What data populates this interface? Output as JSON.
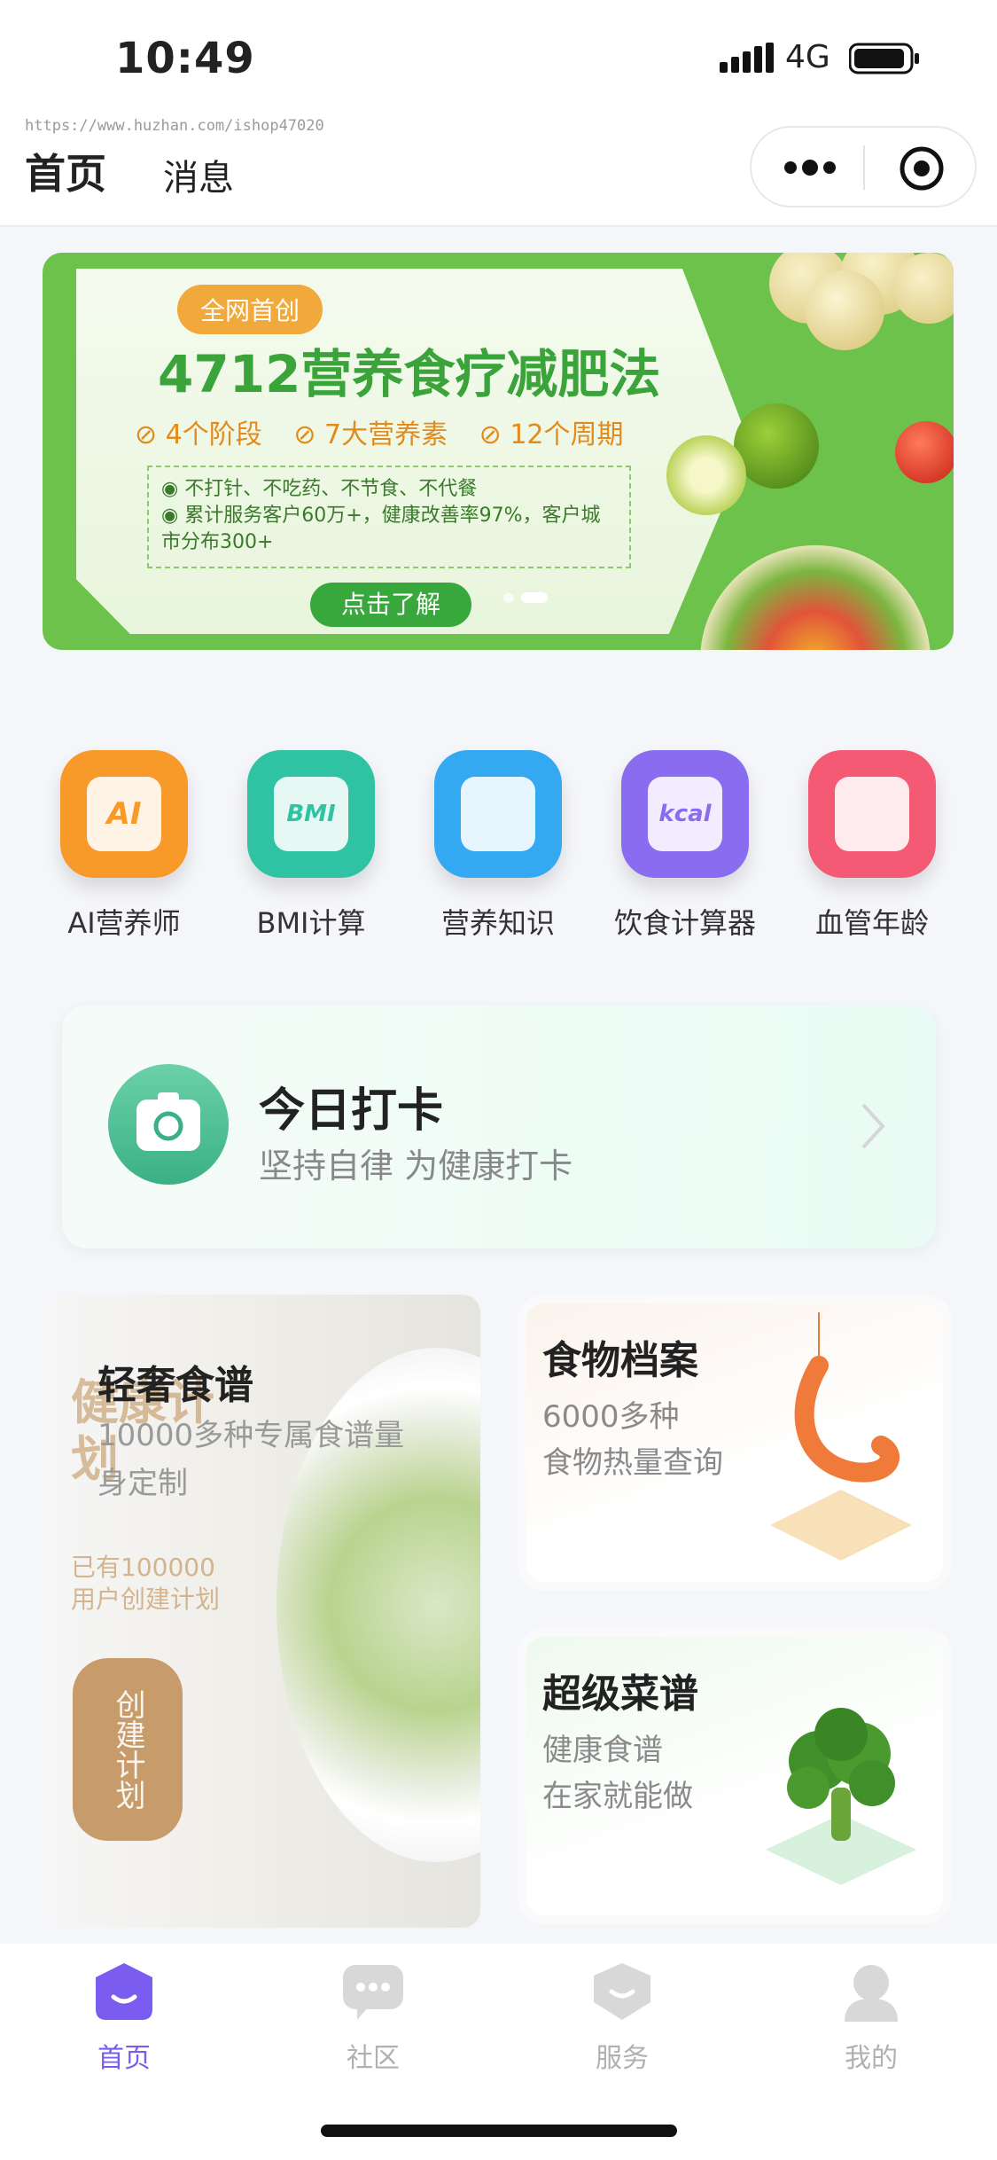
{
  "status_bar": {
    "time": "10:49",
    "network": "4G"
  },
  "header": {
    "url": "https://www.huzhan.com/ishop47020",
    "tabs": [
      {
        "label": "首页",
        "active": true
      },
      {
        "label": "消息",
        "active": false
      }
    ]
  },
  "banner": {
    "tag": "全网首创",
    "title": "4712营养食疗减肥法",
    "features": [
      "4个阶段",
      "7大营养素",
      "12个周期"
    ],
    "points": [
      "不打针、不吃药、不节食、不代餐",
      "累计服务客户60万+，健康改善率97%，客户城市分布300+"
    ],
    "button": "点击了解",
    "slide_count": 2,
    "active_slide": 2
  },
  "grid": [
    {
      "label": "AI营养师",
      "icon": "ai-nutritionist-icon",
      "glyph": "AI",
      "color": "#f79a2a"
    },
    {
      "label": "BMI计算",
      "icon": "bmi-calculator-icon",
      "glyph": "BMI",
      "color": "#2fc3a4"
    },
    {
      "label": "营养知识",
      "icon": "nutrition-knowledge-icon",
      "glyph": "",
      "color": "#35a8f2"
    },
    {
      "label": "饮食计算器",
      "icon": "diet-calculator-icon",
      "glyph": "kcal",
      "color": "#8a6cf0"
    },
    {
      "label": "血管年龄",
      "icon": "vascular-age-icon",
      "glyph": "",
      "color": "#f45a74"
    }
  ],
  "checkin": {
    "title": "今日打卡",
    "subtitle": "坚持自律 为健康打卡"
  },
  "cards": {
    "recipe": {
      "title": "轻奢食谱",
      "desc": "10000多种专属食谱量身定制",
      "overlay_title": "健康计划",
      "overlay_sub": "已有100000用户创建计划",
      "overlay_button": "创建计划"
    },
    "food": {
      "title": "食物档案",
      "line1": "6000多种",
      "line2": "食物热量查询"
    },
    "menu": {
      "title": "超级菜谱",
      "line1": "健康食谱",
      "line2": "在家就能做"
    }
  },
  "tabbar": [
    {
      "label": "首页",
      "icon": "home-icon",
      "active": true
    },
    {
      "label": "社区",
      "icon": "community-icon",
      "active": false
    },
    {
      "label": "服务",
      "icon": "service-icon",
      "active": false
    },
    {
      "label": "我的",
      "icon": "profile-icon",
      "active": false
    }
  ],
  "colors": {
    "accent": "#7a5cf0",
    "banner_green": "#6cc24a",
    "checkin_green": "#3bb085"
  }
}
